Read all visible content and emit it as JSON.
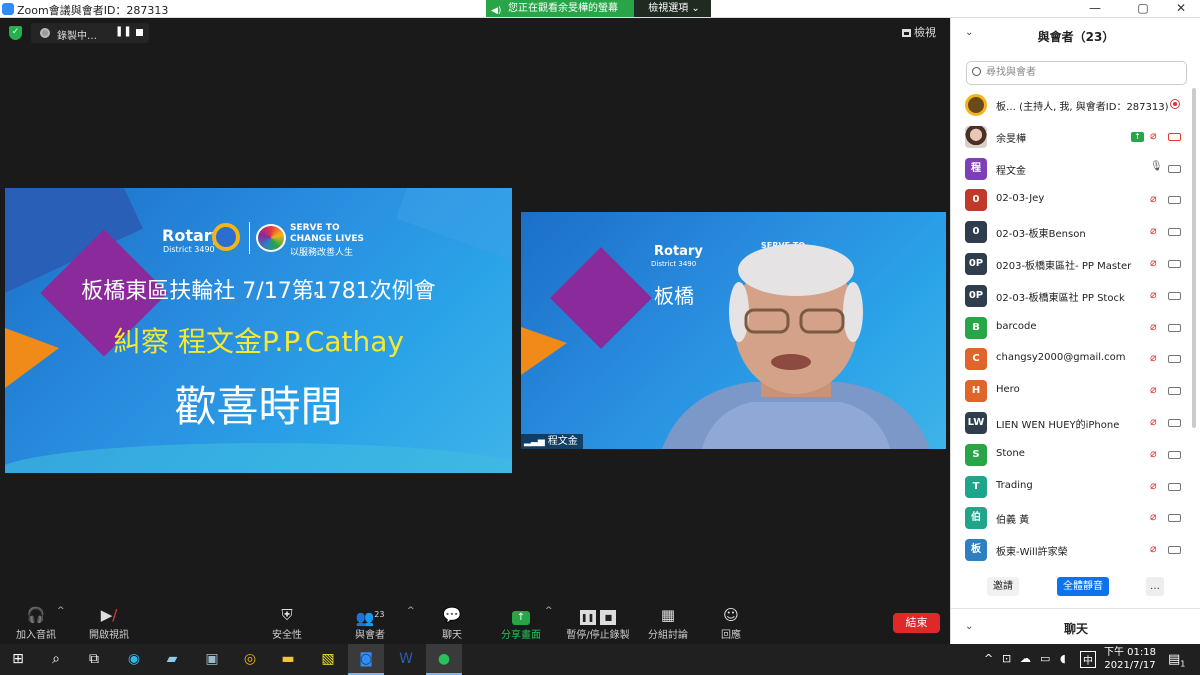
{
  "window": {
    "title": "Zoom會議與會者ID：287313",
    "min": "—",
    "max": "▢",
    "close": "✕"
  },
  "view_bar": {
    "notice": "您正在觀看余旻樺的螢幕",
    "options": "檢視選項 ⌄"
  },
  "meeting": {
    "recording_label": "錄製中…",
    "view_label": "檢視",
    "slide": {
      "rotary": "Rotary",
      "district": "District 3490",
      "serve1": "SERVE TO",
      "serve2": "CHANGE LIVES",
      "serve3": "以服務改善人生",
      "line1": "板橋東區扶輪社  7/17第1781次例會",
      "line2_prefix": "糾察 ",
      "line2_name": "程文金P.P.Cathay",
      "line3": "歡喜時間"
    },
    "video_slide_partial": "板橋",
    "video_label": "程文金"
  },
  "toolbar": {
    "audio": "加入音訊",
    "video": "開啟視訊",
    "security": "安全性",
    "participants": "與會者",
    "participants_count": "23",
    "chat": "聊天",
    "share": "分享畫面",
    "record": "暫停/停止錄製",
    "breakout": "分組討論",
    "reactions": "回應",
    "end": "結束"
  },
  "panel": {
    "title": "與會者（23）",
    "search_placeholder": "尋找與會者",
    "participants": [
      {
        "avatar": "",
        "name": "板…    (主持人, 我, 與會者ID：287313)",
        "color": "#6a4a1a",
        "kind": "host"
      },
      {
        "avatar": "",
        "name": "余旻樺",
        "color": "#c99a82",
        "kind": "photo"
      },
      {
        "avatar": "程",
        "name": "程文金",
        "color": "#7d3fb7"
      },
      {
        "avatar": "0",
        "name": "02-03-Jey",
        "color": "#c0392b"
      },
      {
        "avatar": "0",
        "name": "02-03-板東Benson",
        "color": "#2f3e4e"
      },
      {
        "avatar": "0P",
        "name": "0203-板橋東區社- PP Master",
        "color": "#2f3e4e"
      },
      {
        "avatar": "0P",
        "name": "02-03-板橋東區社 PP Stock",
        "color": "#2f3e4e"
      },
      {
        "avatar": "B",
        "name": "barcode",
        "color": "#27a547"
      },
      {
        "avatar": "C",
        "name": "changsy2000@gmail.com",
        "color": "#e0652a"
      },
      {
        "avatar": "H",
        "name": "Hero",
        "color": "#e0652a"
      },
      {
        "avatar": "LW",
        "name": "LIEN WEN HUEY的iPhone",
        "color": "#2f3e4e"
      },
      {
        "avatar": "S",
        "name": "Stone",
        "color": "#27a547"
      },
      {
        "avatar": "T",
        "name": "Trading",
        "color": "#1fa58a"
      },
      {
        "avatar": "伯",
        "name": "伯義 黃",
        "color": "#1fa58a"
      },
      {
        "avatar": "板",
        "name": "板東-Will許家榮",
        "color": "#2d7fc1"
      }
    ],
    "invite": "邀請",
    "mute_all": "全體靜音",
    "more": "…",
    "chat_title": "聊天"
  },
  "taskbar": {
    "clock_time": "下午 01:18",
    "clock_date": "2021/7/17",
    "ime": "中",
    "notifications": "1"
  }
}
